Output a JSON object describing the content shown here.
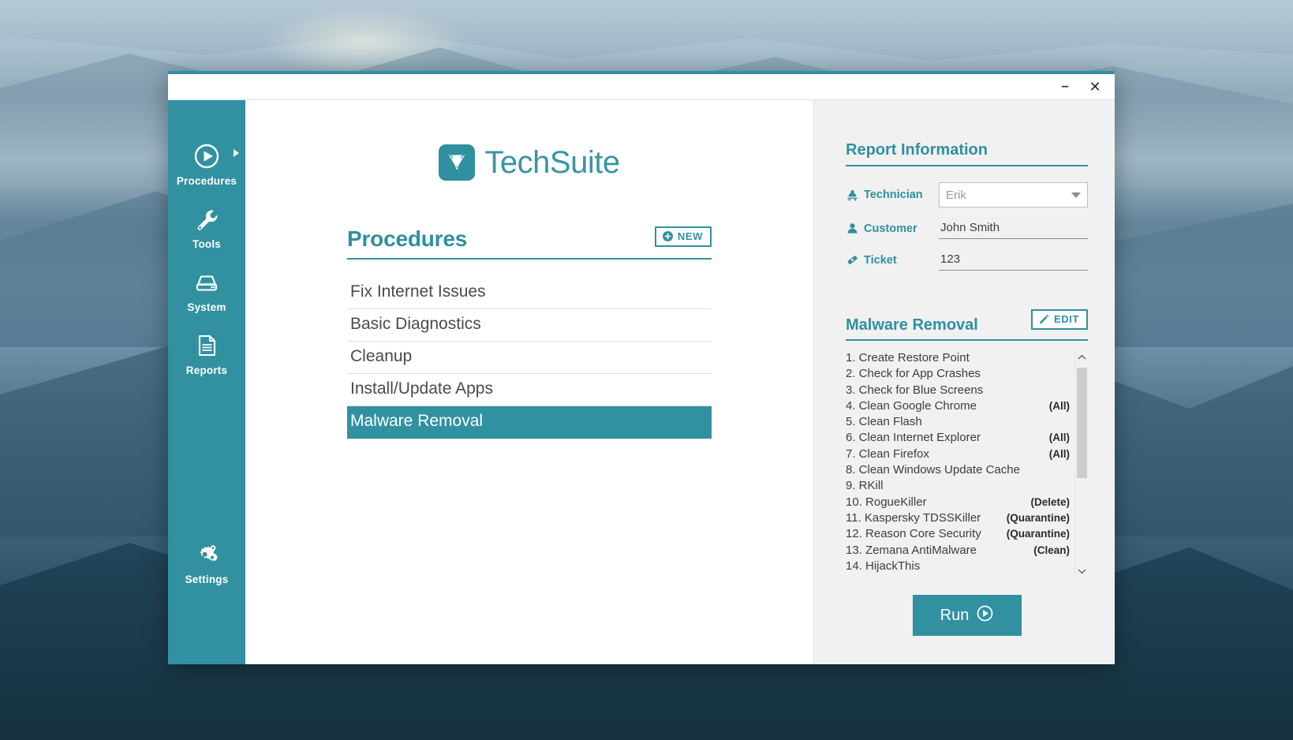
{
  "window": {
    "minimize_label": "–",
    "close_label": "✕"
  },
  "brand": {
    "name": "TechSuite",
    "logo_icon": "techsuite-funnel-logo"
  },
  "sidebar": {
    "items": [
      {
        "label": "Procedures",
        "icon": "play-circle-icon",
        "has_caret": true,
        "active": true
      },
      {
        "label": "Tools",
        "icon": "wrench-icon",
        "has_caret": false,
        "active": false
      },
      {
        "label": "System",
        "icon": "hard-drive-icon",
        "has_caret": false,
        "active": false
      },
      {
        "label": "Reports",
        "icon": "document-lines-icon",
        "has_caret": false,
        "active": false
      }
    ],
    "settings": {
      "label": "Settings",
      "icon": "gears-icon"
    }
  },
  "procedures": {
    "title": "Procedures",
    "new_button": {
      "label": "NEW",
      "icon": "plus-circle-icon"
    },
    "items": [
      {
        "label": "Fix Internet Issues",
        "selected": false
      },
      {
        "label": "Basic Diagnostics",
        "selected": false
      },
      {
        "label": "Cleanup",
        "selected": false
      },
      {
        "label": "Install/Update Apps",
        "selected": false
      },
      {
        "label": "Malware Removal",
        "selected": true
      }
    ]
  },
  "report_information": {
    "title": "Report Information",
    "technician": {
      "label": "Technician",
      "icon": "technician-icon",
      "value": "Erik",
      "placeholder": "Erik",
      "type": "dropdown"
    },
    "customer": {
      "label": "Customer",
      "icon": "person-icon",
      "value": "John Smith",
      "type": "text"
    },
    "ticket": {
      "label": "Ticket",
      "icon": "ticket-icon",
      "value": "123",
      "type": "text"
    }
  },
  "malware_removal": {
    "title": "Malware Removal",
    "edit_button": {
      "label": "EDIT",
      "icon": "pencil-icon"
    },
    "tasks": [
      {
        "number": "1.",
        "name": "Create Restore Point",
        "flag": ""
      },
      {
        "number": "2.",
        "name": "Check for App Crashes",
        "flag": ""
      },
      {
        "number": "3.",
        "name": "Check for Blue Screens",
        "flag": ""
      },
      {
        "number": "4.",
        "name": "Clean Google Chrome",
        "flag": "(All)"
      },
      {
        "number": "5.",
        "name": "Clean Flash",
        "flag": ""
      },
      {
        "number": "6.",
        "name": "Clean Internet Explorer",
        "flag": "(All)"
      },
      {
        "number": "7.",
        "name": "Clean Firefox",
        "flag": "(All)"
      },
      {
        "number": "8.",
        "name": "Clean Windows Update Cache",
        "flag": ""
      },
      {
        "number": "9.",
        "name": "RKill",
        "flag": ""
      },
      {
        "number": "10.",
        "name": "RogueKiller",
        "flag": "(Delete)"
      },
      {
        "number": "11.",
        "name": "Kaspersky TDSSKiller",
        "flag": "(Quarantine)"
      },
      {
        "number": "12.",
        "name": "Reason Core Security",
        "flag": "(Quarantine)"
      },
      {
        "number": "13.",
        "name": "Zemana AntiMalware",
        "flag": "(Clean)"
      },
      {
        "number": "14.",
        "name": "HijackThis",
        "flag": ""
      }
    ],
    "scrollbar": {
      "up_icon": "chevron-up-icon",
      "down_icon": "chevron-down-icon"
    }
  },
  "run_button": {
    "label": "Run",
    "icon": "play-circle-icon"
  },
  "colors": {
    "teal": "#3191a1",
    "teal_text": "#2f90a0",
    "panel_bg": "#f1f1f1",
    "list_text": "#4a4a4a"
  }
}
